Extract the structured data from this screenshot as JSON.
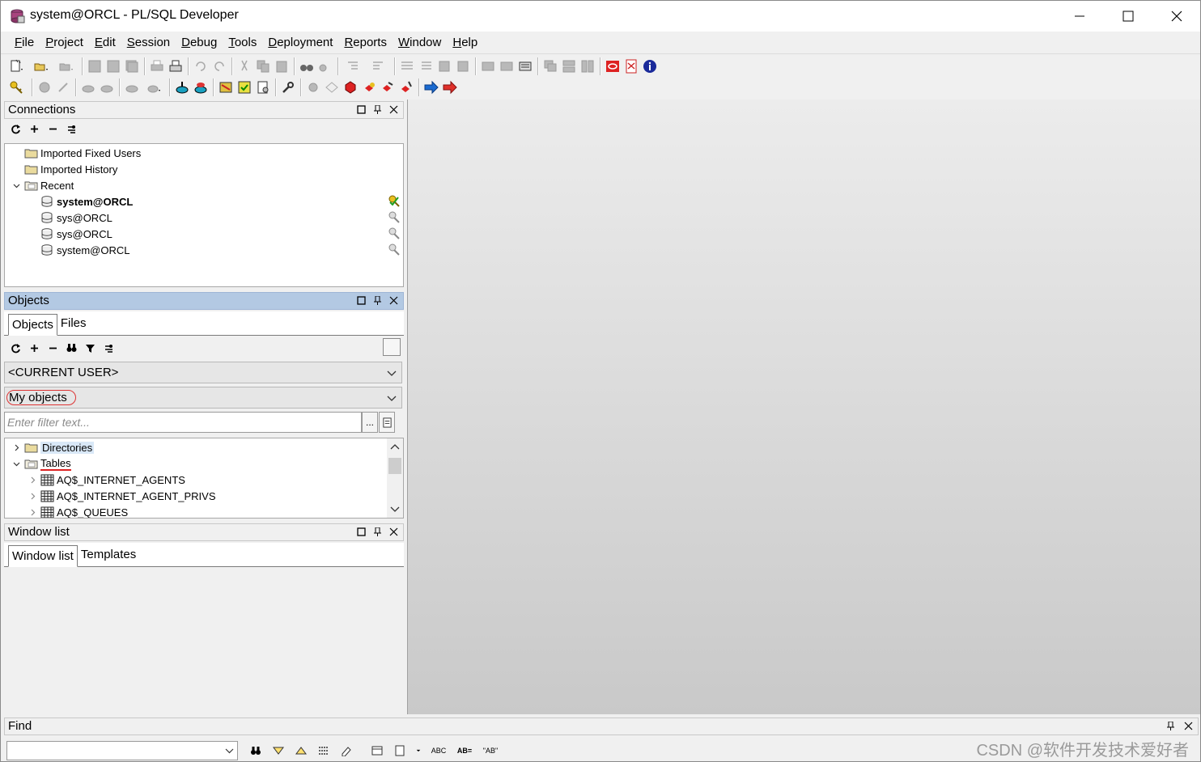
{
  "window": {
    "title": "system@ORCL - PL/SQL Developer"
  },
  "menu": [
    "File",
    "Project",
    "Edit",
    "Session",
    "Debug",
    "Tools",
    "Deployment",
    "Reports",
    "Window",
    "Help"
  ],
  "connections": {
    "title": "Connections",
    "items": [
      {
        "label": "Imported Fixed Users",
        "icon": "folder-icon"
      },
      {
        "label": "Imported History",
        "icon": "folder-icon"
      },
      {
        "label": "Recent",
        "icon": "folder-open-icon"
      },
      {
        "label": "system@ORCL",
        "icon": "database-icon",
        "bold": true,
        "status": "connected-key-icon"
      },
      {
        "label": "sys@ORCL",
        "icon": "database-icon",
        "status": "key-icon"
      },
      {
        "label": "sys@ORCL",
        "icon": "database-icon",
        "status": "key-icon"
      },
      {
        "label": "system@ORCL",
        "icon": "database-icon",
        "status": "key-icon"
      }
    ]
  },
  "objects": {
    "title": "Objects",
    "tabs": [
      "Objects",
      "Files"
    ],
    "user_combo": "<CURRENT USER>",
    "scope_combo": "My objects",
    "filter_placeholder": "Enter filter text...",
    "filter_btn": "...",
    "tree": [
      {
        "label": "Directories",
        "icon": "folder-icon"
      },
      {
        "label": "Tables",
        "icon": "folder-open-icon"
      },
      {
        "label": "AQ$_INTERNET_AGENTS",
        "icon": "table-icon"
      },
      {
        "label": "AQ$_INTERNET_AGENT_PRIVS",
        "icon": "table-icon"
      },
      {
        "label": "AQ$_QUEUES",
        "icon": "table-icon"
      }
    ]
  },
  "windowlist": {
    "title": "Window list",
    "tabs": [
      "Window list",
      "Templates"
    ]
  },
  "find": {
    "title": "Find",
    "tools": [
      "ABC",
      "AB=",
      "\"AB\""
    ]
  },
  "watermark": "CSDN @软件开发技术爱好者",
  "colors": {
    "active_header": "#b3c9e3",
    "selection": "#d9e8f7",
    "highlight_ring": "#dd3333"
  }
}
